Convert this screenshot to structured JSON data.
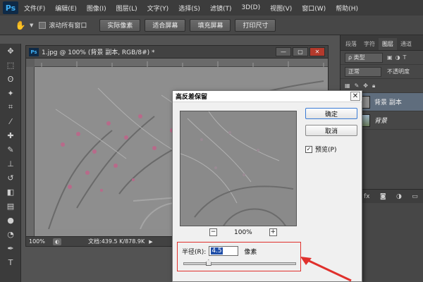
{
  "app": {
    "logo": "Ps"
  },
  "menu": [
    "文件(F)",
    "编辑(E)",
    "图像(I)",
    "图层(L)",
    "文字(Y)",
    "选择(S)",
    "滤镜(T)",
    "3D(D)",
    "视图(V)",
    "窗口(W)",
    "帮助(H)"
  ],
  "options": {
    "scroll_all_label": "滚动所有窗口",
    "buttons": [
      "实际像素",
      "适合屏幕",
      "填充屏幕",
      "打印尺寸"
    ]
  },
  "tools": [
    "move-tool",
    "marquee-tool",
    "lasso-tool",
    "magic-wand-tool",
    "crop-tool",
    "eyedropper-tool",
    "healing-brush-tool",
    "brush-tool",
    "clone-stamp-tool",
    "history-brush-tool",
    "eraser-tool",
    "gradient-tool",
    "blur-tool",
    "dodge-tool",
    "pen-tool",
    "type-tool"
  ],
  "document": {
    "icon_label": "Ps",
    "title": "1.jpg @ 100% (背景 副本, RGB/8#) *",
    "zoom": "100%",
    "doc_info": "文档:439.5 K/878.9K"
  },
  "panels": {
    "tabs": [
      "段落",
      "字符",
      "图层",
      "通道"
    ],
    "active_tab": "图层",
    "kind_label": "ρ 类型",
    "blend_mode": "正常",
    "opacity_label": "不透明度",
    "layers": [
      {
        "name": "背景 副本",
        "selected": true
      },
      {
        "name": "背景",
        "selected": false
      }
    ],
    "footer_icons": [
      "link-icon",
      "fx-icon",
      "mask-icon",
      "adjustment-icon",
      "folder-icon"
    ]
  },
  "dialog": {
    "title": "高反差保留",
    "ok_label": "确定",
    "cancel_label": "取消",
    "preview_label": "预览(P)",
    "preview_checked": true,
    "zoom_value": "100%",
    "zoom_minus": "−",
    "zoom_plus": "+",
    "radius_label": "半径(R):",
    "radius_value": "4.5",
    "radius_unit": "像素",
    "slider_fraction": 0.22
  },
  "colors": {
    "accent_red": "#e0302c",
    "selection_blue": "#1f4ea8"
  }
}
